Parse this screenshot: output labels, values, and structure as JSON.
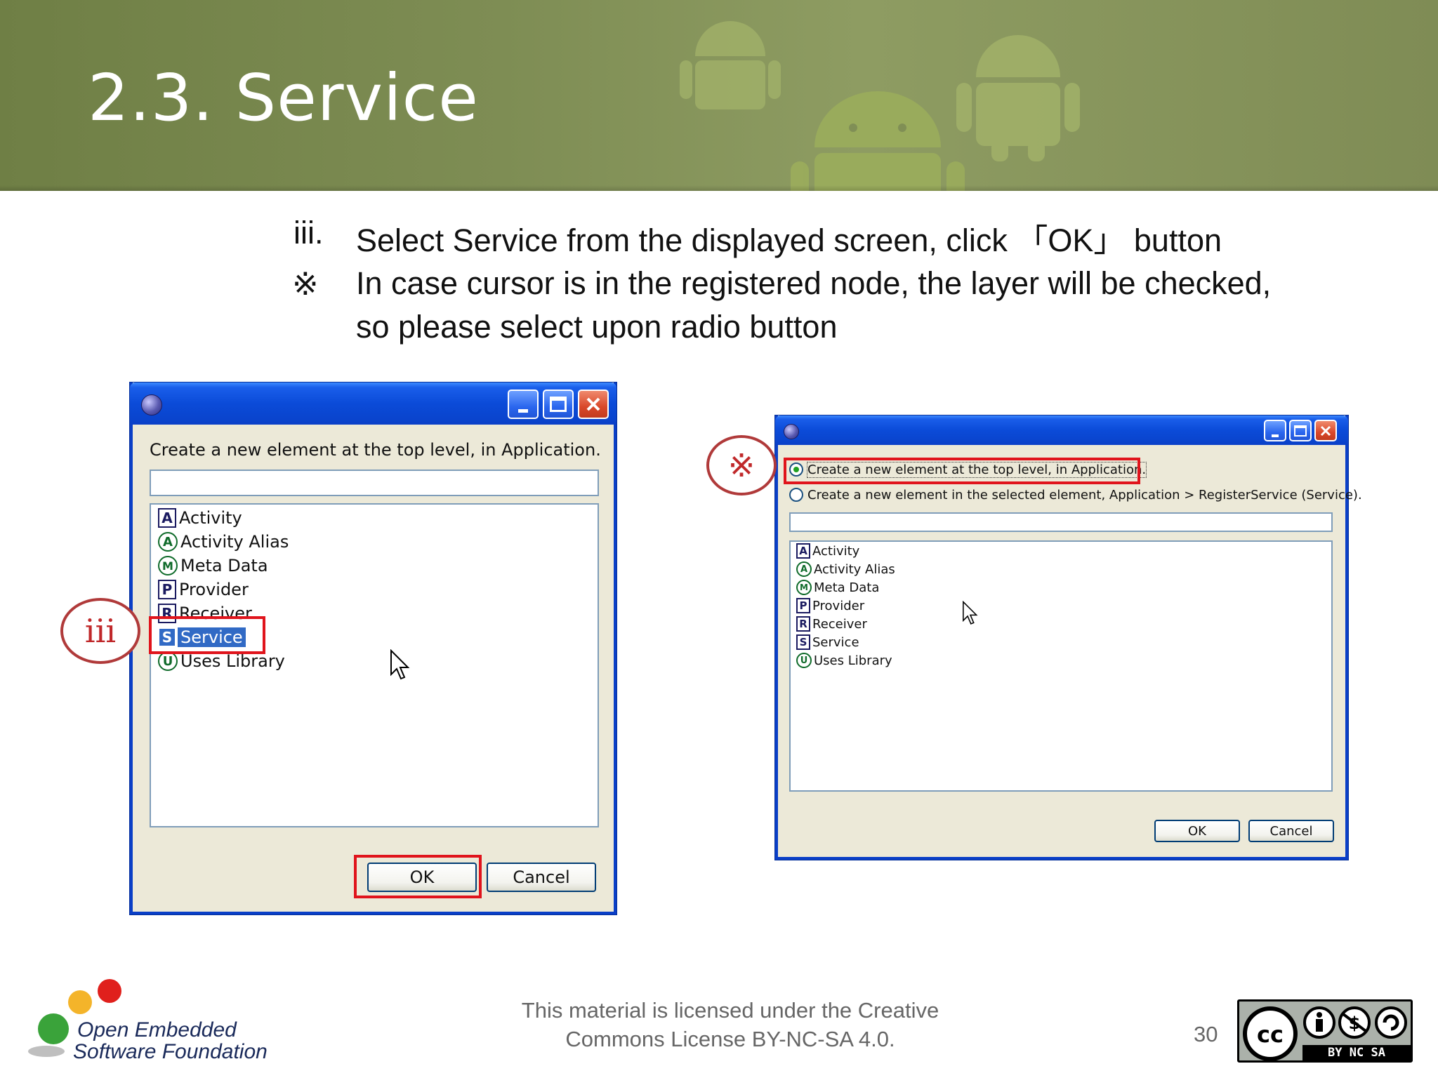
{
  "slide": {
    "title": "2.3. Service",
    "instruction_marker": "iii.",
    "instruction_text": "Select Service from the displayed screen,  click  「OK」  button",
    "note_marker": "※",
    "note_line1": " In case cursor is in the registered node, the layer will be checked,",
    "note_line2": "so please select upon radio button"
  },
  "dialog_left": {
    "prompt": "Create a new element at the top level, in Application.",
    "filter_value": "",
    "items": [
      {
        "badge": "A",
        "shape": "square",
        "label": "Activity"
      },
      {
        "badge": "A",
        "shape": "circle",
        "label": "Activity Alias"
      },
      {
        "badge": "M",
        "shape": "circle",
        "label": "Meta Data"
      },
      {
        "badge": "P",
        "shape": "square",
        "label": "Provider"
      },
      {
        "badge": "R",
        "shape": "square",
        "label": "Receiver"
      },
      {
        "badge": "S",
        "shape": "square",
        "label": "Service",
        "selected": true
      },
      {
        "badge": "U",
        "shape": "circle",
        "label": "Uses Library"
      }
    ],
    "ok_label": "OK",
    "cancel_label": "Cancel"
  },
  "dialog_right": {
    "radio_top_label": "Create a new element at the top level, in Application.",
    "radio_selected_label": "Create a new element in the selected element, Application > RegisterService (Service).",
    "filter_value": "",
    "items": [
      {
        "badge": "A",
        "shape": "square",
        "label": "Activity"
      },
      {
        "badge": "A",
        "shape": "circle",
        "label": "Activity Alias"
      },
      {
        "badge": "M",
        "shape": "circle",
        "label": "Meta Data"
      },
      {
        "badge": "P",
        "shape": "square",
        "label": "Provider"
      },
      {
        "badge": "R",
        "shape": "square",
        "label": "Receiver"
      },
      {
        "badge": "S",
        "shape": "square",
        "label": "Service"
      },
      {
        "badge": "U",
        "shape": "circle",
        "label": "Uses Library"
      }
    ],
    "ok_label": "OK",
    "cancel_label": "Cancel"
  },
  "callouts": {
    "left": "iii",
    "right": "※"
  },
  "footer": {
    "license_line1": "This material is licensed under the Creative",
    "license_line2": "Commons License BY-NC-SA 4.0.",
    "page_number": "30",
    "org_line1": "Open Embedded",
    "org_line2": "Software Foundation",
    "cc_badge_text": "BY NC SA"
  },
  "colors": {
    "banner": "#7e8d54",
    "xp_title_blue": "#0a44cd",
    "xp_face": "#ece9d8",
    "highlight_red": "#e0141c",
    "callout_red": "#c0282a"
  }
}
